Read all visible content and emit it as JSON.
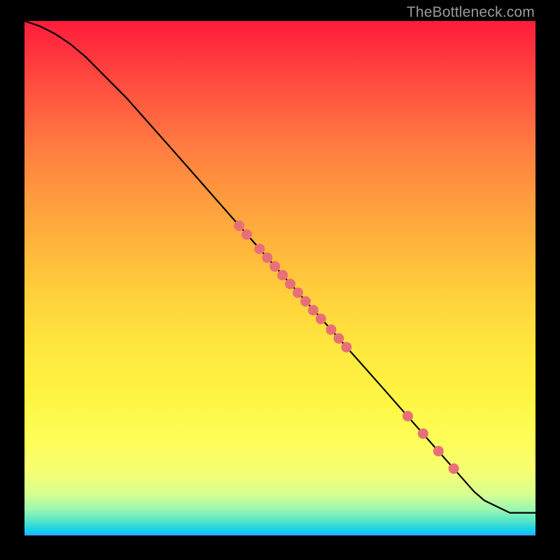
{
  "watermark": "TheBottleneck.com",
  "chart_data": {
    "type": "line",
    "title": "",
    "xlabel": "",
    "ylabel": "",
    "xlim": [
      0,
      100
    ],
    "ylim": [
      0,
      100
    ],
    "series": [
      {
        "name": "curve",
        "x": [
          0,
          3,
          6,
          9,
          12,
          15,
          20,
          30,
          40,
          50,
          60,
          70,
          80,
          88,
          90,
          95,
          100
        ],
        "y": [
          100,
          99,
          97.5,
          95.5,
          93,
          90,
          85,
          73.8,
          62.5,
          51.2,
          40,
          28.8,
          17.5,
          8.5,
          6.8,
          4.4,
          4.4
        ]
      }
    ],
    "markers": [
      {
        "x": 42,
        "y": 60.2
      },
      {
        "x": 43.5,
        "y": 58.5
      },
      {
        "x": 46,
        "y": 55.7
      },
      {
        "x": 47.5,
        "y": 54.0
      },
      {
        "x": 49,
        "y": 52.3
      },
      {
        "x": 50.5,
        "y": 50.6
      },
      {
        "x": 52,
        "y": 48.9
      },
      {
        "x": 53.5,
        "y": 47.2
      },
      {
        "x": 55,
        "y": 45.5
      },
      {
        "x": 56.5,
        "y": 43.8
      },
      {
        "x": 58,
        "y": 42.1
      },
      {
        "x": 60,
        "y": 40.0
      },
      {
        "x": 61.5,
        "y": 38.3
      },
      {
        "x": 63,
        "y": 36.6
      },
      {
        "x": 75,
        "y": 23.2
      },
      {
        "x": 78,
        "y": 19.8
      },
      {
        "x": 81,
        "y": 16.4
      },
      {
        "x": 84,
        "y": 13.0
      }
    ],
    "colors": {
      "line": "#000000",
      "marker": "#e86f78"
    }
  }
}
